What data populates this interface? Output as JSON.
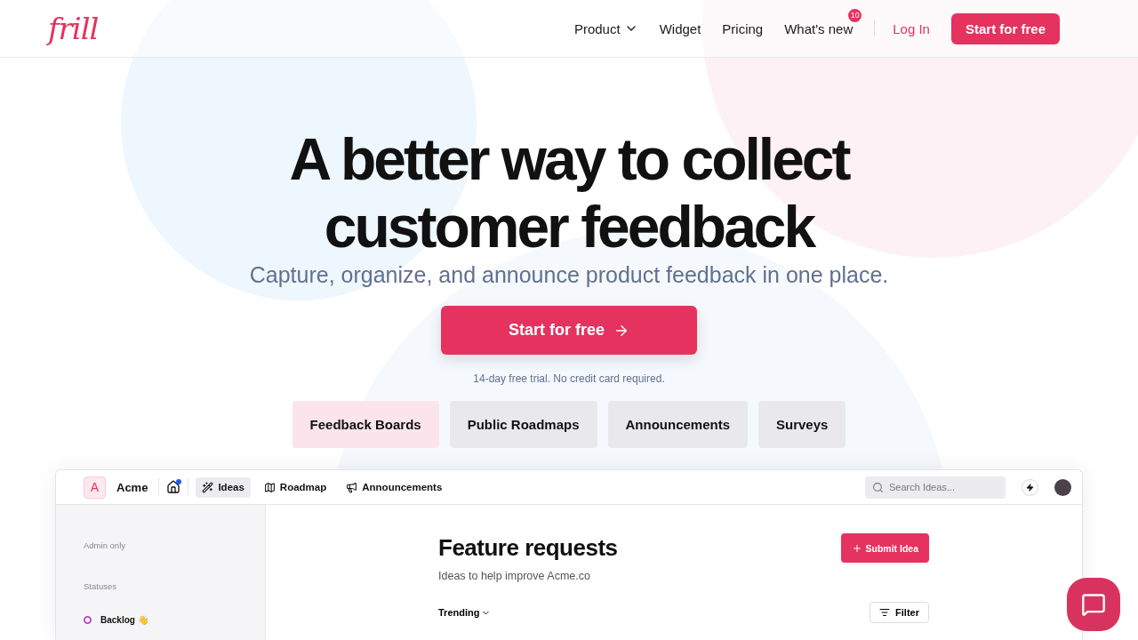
{
  "header": {
    "logo": "frill",
    "nav": [
      {
        "label": "Product",
        "kind": "dropdown"
      },
      {
        "label": "Widget",
        "kind": "link"
      },
      {
        "label": "Pricing",
        "kind": "link"
      },
      {
        "label": "What's new",
        "kind": "badge",
        "badge": "10"
      }
    ],
    "login": "Log In",
    "cta": "Start for free"
  },
  "hero": {
    "title_lines": [
      "A better way to collect",
      "customer feedback"
    ],
    "subtitle": "Capture, organize, and announce product feedback in one place.",
    "cta": "Start for free",
    "note": "14-day free trial. No credit card required.",
    "tabs": [
      {
        "label": "Feedback Boards",
        "selected": true
      },
      {
        "label": "Public Roadmaps",
        "selected": false
      },
      {
        "label": "Announcements",
        "selected": false
      },
      {
        "label": "Surveys",
        "selected": false
      }
    ]
  },
  "app": {
    "workspace_initial": "A",
    "workspace_name": "Acme",
    "home_notification": true,
    "nav": [
      {
        "label": "Ideas",
        "selected": true
      },
      {
        "label": "Roadmap",
        "selected": false
      },
      {
        "label": "Announcements",
        "selected": false
      }
    ],
    "search_placeholder": "Search Ideas...",
    "sidebar": {
      "sections": [
        "Admin only",
        "Statuses"
      ],
      "statuses": [
        {
          "label": "Backlog 👋",
          "color": "#c43bd6"
        }
      ]
    },
    "main": {
      "title": "Feature requests",
      "subtitle": "Ideas to help improve Acme.co",
      "submit": "Submit Idea",
      "sort": "Trending",
      "filter": "Filter"
    }
  }
}
